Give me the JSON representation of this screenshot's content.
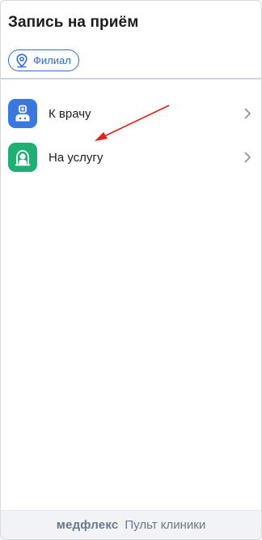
{
  "header": {
    "title": "Запись на приём",
    "branch_chip": {
      "label": "Филиал",
      "icon": "location-pin-icon"
    }
  },
  "menu": {
    "items": [
      {
        "label": "К врачу",
        "icon": "doctor-icon",
        "color": "#3a78e0"
      },
      {
        "label": "На услугу",
        "icon": "service-icon",
        "color": "#1fae74"
      }
    ]
  },
  "annotation": {
    "color": "#e0201b"
  },
  "footer": {
    "brand": "медфлекс",
    "subtitle": "Пульт клиники"
  }
}
